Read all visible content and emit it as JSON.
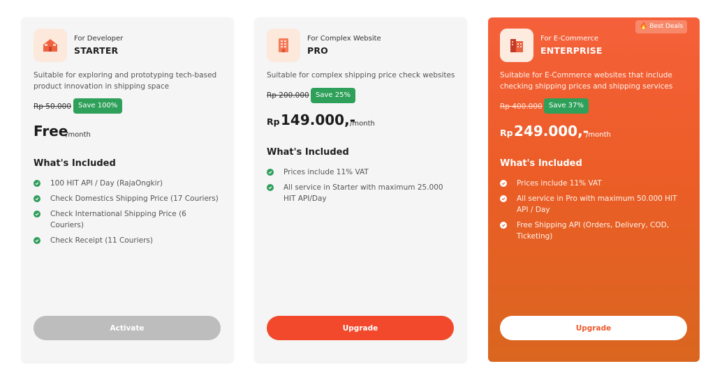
{
  "plans": [
    {
      "tagline": "For Developer",
      "name": "STARTER",
      "icon": "house-icon",
      "description": "Suitable for exploring and prototyping tech-based product innovation in shipping space",
      "old_price": "Rp 50.000",
      "save_label": "Save 100%",
      "price": "Free",
      "per": "/month",
      "included_title": "What's Included",
      "features": [
        "100 HIT API / Day (RajaOngkir)",
        "Check Domestics Shipping Price (17 Couriers)",
        "Check International Shipping Price (6 Couriers)",
        "Check Receipt (11 Couriers)"
      ],
      "cta": "Activate",
      "cta_enabled": false
    },
    {
      "tagline": "For Complex Website",
      "name": "PRO",
      "icon": "building-icon",
      "description": "Suitable for complex shipping price check websites",
      "old_price": "Rp 200.000",
      "save_label": "Save 25%",
      "currency": "Rp",
      "price": "149.000,-",
      "per": "/month",
      "included_title": "What's Included",
      "features": [
        "Prices include 11% VAT",
        "All service in Starter with maximum 25.000 HIT API/Day"
      ],
      "cta": "Upgrade",
      "cta_enabled": true
    },
    {
      "tagline": "For E-Commerce",
      "name": "ENTERPRISE",
      "icon": "office-tower-icon",
      "badge": "Best Deals",
      "description": "Suitable for E-Commerce websites that include checking shipping prices and shipping services",
      "old_price": "Rp 400.000",
      "save_label": "Save 37%",
      "currency": "Rp",
      "price": "249.000,-",
      "per": "/month",
      "included_title": "What's Included",
      "features": [
        "Prices include 11% VAT",
        "All service in Pro with maximum 50.000 HIT API / Day",
        "Free Shipping API (Orders, Delivery, COD, Ticketing)"
      ],
      "cta": "Upgrade",
      "cta_enabled": true
    }
  ],
  "colors": {
    "save_badge": "#2fa05a",
    "check": "#2f9d5c",
    "accent": "#f2492c",
    "enterprise_gradient_top": "#f5603a",
    "enterprise_gradient_bottom": "#d9661f",
    "disabled_button": "#bdbdbd"
  }
}
